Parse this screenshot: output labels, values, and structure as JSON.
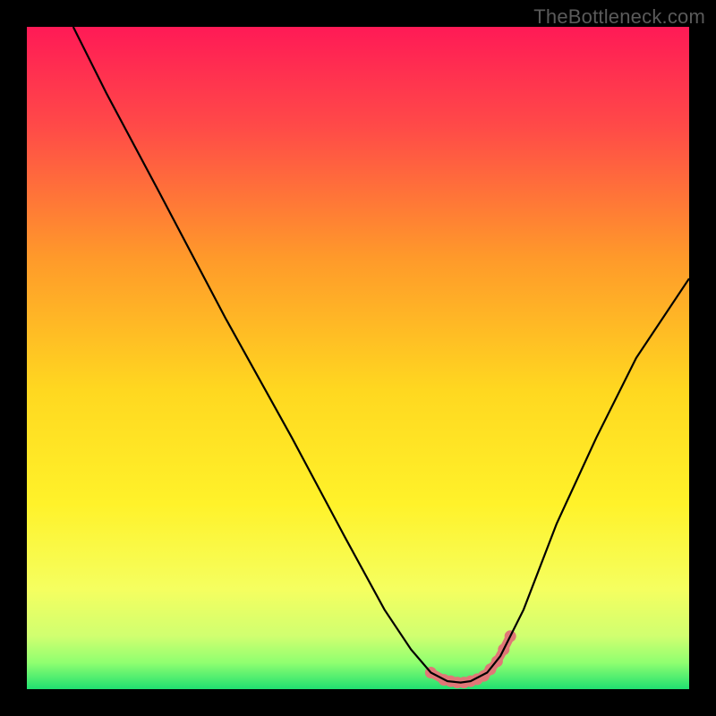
{
  "watermark": "TheBottleneck.com",
  "chart_data": {
    "type": "line",
    "title": "",
    "xlabel": "",
    "ylabel": "",
    "xlim": [
      0,
      100
    ],
    "ylim": [
      0,
      100
    ],
    "series": [
      {
        "name": "curve",
        "x": [
          7,
          12,
          20,
          30,
          40,
          48,
          54,
          58,
          61,
          63.5,
          65.5,
          67,
          69.5,
          71.5,
          73,
          75,
          80,
          86,
          92,
          100
        ],
        "y": [
          100,
          90,
          75,
          56,
          38,
          23,
          12,
          6,
          2.5,
          1.2,
          1.0,
          1.2,
          2.5,
          5,
          8,
          12,
          25,
          38,
          50,
          62
        ]
      }
    ],
    "marker_region": {
      "color": "#e07777",
      "points_x": [
        61,
        63,
        64,
        65,
        66,
        67,
        68,
        69,
        70,
        71,
        72,
        73
      ],
      "points_y": [
        2.5,
        1.4,
        1.2,
        1.0,
        1.0,
        1.2,
        1.5,
        2.0,
        3.0,
        4.2,
        6.0,
        8.0
      ]
    },
    "gradient_stops": [
      {
        "pos": 0.0,
        "color": "#ff1a56"
      },
      {
        "pos": 0.15,
        "color": "#ff4a48"
      },
      {
        "pos": 0.35,
        "color": "#ff9a2a"
      },
      {
        "pos": 0.55,
        "color": "#ffd820"
      },
      {
        "pos": 0.72,
        "color": "#fff22a"
      },
      {
        "pos": 0.85,
        "color": "#f5ff60"
      },
      {
        "pos": 0.92,
        "color": "#d0ff70"
      },
      {
        "pos": 0.96,
        "color": "#90ff70"
      },
      {
        "pos": 1.0,
        "color": "#20e070"
      }
    ]
  }
}
